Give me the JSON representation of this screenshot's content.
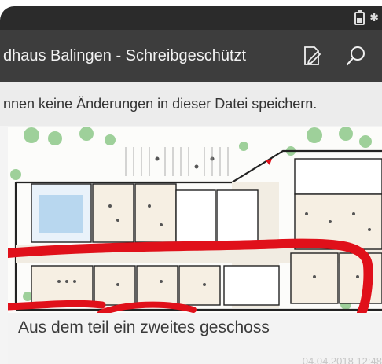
{
  "app": {
    "title": "dhaus Balingen - Schreibgeschützt",
    "info_text": "nnen keine Änderungen in dieser Datei speichern."
  },
  "toolbar": {
    "edit_icon": "edit-document-icon",
    "search_icon": "search-icon"
  },
  "note": {
    "caption": "Aus dem teil ein zweites geschoss",
    "timestamp": "04.04.2018 12:48"
  },
  "colors": {
    "status_bar": "#2b2b2b",
    "app_bar": "#3d3d3d",
    "info_bar": "#ececec",
    "ink_stroke": "#e0101a"
  }
}
